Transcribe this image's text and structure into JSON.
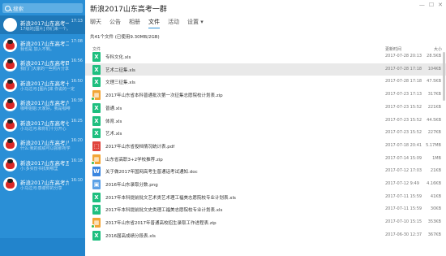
{
  "search": {
    "placeholder": "搜索"
  },
  "conversations": [
    {
      "name": "新浪2017山东高考一群",
      "time": "17:13",
      "msg": "17级的[图片] 你们来一个。",
      "avatar": "sina"
    },
    {
      "name": "新浪2017山东高考二群",
      "time": "17:08",
      "msg": "我也是 加入不到。",
      "avatar": "angry"
    },
    {
      "name": "新浪2017山东高考四群",
      "time": "16:56",
      "msg": "我们门大家的一些照片分享",
      "avatar": "angry"
    },
    {
      "name": "新浪2017山东高考十群",
      "time": "16:50",
      "msg": "小马过河:[图片]来 你说的一定",
      "avatar": "angry"
    },
    {
      "name": "新浪2017山东高考六群",
      "time": "16:38",
      "msg": "咖啡姐姐:大家好，我是咖啡",
      "avatar": "angry"
    },
    {
      "name": "新浪2017山东高考七群",
      "time": "16:25",
      "msg": "小马过河:和你们十分开心",
      "avatar": "angry"
    },
    {
      "name": "新浪2017山东高考八群",
      "time": "16:20",
      "msg": "什么:我的成绩可以报那所学",
      "avatar": "angry"
    },
    {
      "name": "新浪2017山东高考五群",
      "time": "16:18",
      "msg": "小:多买份书找到哪里",
      "avatar": "angry"
    },
    {
      "name": "新浪2017山东高考九群",
      "time": "16:10",
      "msg": "小马过河:感谢你的分享",
      "avatar": "angry"
    }
  ],
  "main": {
    "title": "新浪2017山东高考一群",
    "tabs": [
      "聊天",
      "公告",
      "相册",
      "文件",
      "活动",
      "设置"
    ],
    "active_tab": "文件",
    "info": "共41个文件 (已使用9.30MB/2GB)",
    "col_file": "文件",
    "col_time": "更新时间",
    "col_size": "大小"
  },
  "files": [
    {
      "name": "专科文化.xls",
      "date": "2017-07-28 20:13",
      "size": "28.5KB",
      "type": "xls"
    },
    {
      "name": "艺术二征集.xls",
      "date": "2017-07-28 17:18",
      "size": "104KB",
      "type": "xls",
      "selected": true
    },
    {
      "name": "文理三征集.xls",
      "date": "2017-07-28 17:18",
      "size": "47.5KB",
      "type": "xls"
    },
    {
      "name": "2017年山东省本科普通批次第一次征集志愿院校计划表.zip",
      "date": "2017-07-23 17:13",
      "size": "317KB",
      "type": "zip",
      "ok": true
    },
    {
      "name": "普通.xls",
      "date": "2017-07-23 15:52",
      "size": "221KB",
      "type": "xls"
    },
    {
      "name": "体育.xls",
      "date": "2017-07-23 15:52",
      "size": "44.5KB",
      "type": "xls"
    },
    {
      "name": "艺术.xls",
      "date": "2017-07-23 15:52",
      "size": "227KB",
      "type": "xls"
    },
    {
      "name": "2017年山东省投档情况统计表.pdf",
      "date": "2017-07-18 20:41",
      "size": "5.17MB",
      "type": "pdf"
    },
    {
      "name": "山东省高职3+2学校推荐.zip",
      "date": "2017-07-14 15:09",
      "size": "1MB",
      "type": "zip",
      "ok": true
    },
    {
      "name": "关于做2017年国网高考生普通话考试通知.doc",
      "date": "2017-07-12 17:03",
      "size": "21KB",
      "type": "doc"
    },
    {
      "name": "2016年山东录取分数.png",
      "date": "2017-07-12 9:49",
      "size": "4.16KB",
      "type": "png"
    },
    {
      "name": "2017年本科提前批文艺术类艺术理工福美志愿院校专业计划表.xls",
      "date": "2017-07-11 15:59",
      "size": "41KB",
      "type": "xls"
    },
    {
      "name": "2017年本科提前批文史类理工福美志愿院校专业计划表.xls",
      "date": "2017-07-11 15:59",
      "size": "30KB",
      "type": "xls"
    },
    {
      "name": "2017年山东省2017年普通高校招生录取工作进程表.zip",
      "date": "2017-07-10 15:15",
      "size": "353KB",
      "type": "zip",
      "ok": true
    },
    {
      "name": "2016届高成绩分段表.xls",
      "date": "2017-06-30 12:37",
      "size": "367KB",
      "type": "xls"
    }
  ]
}
